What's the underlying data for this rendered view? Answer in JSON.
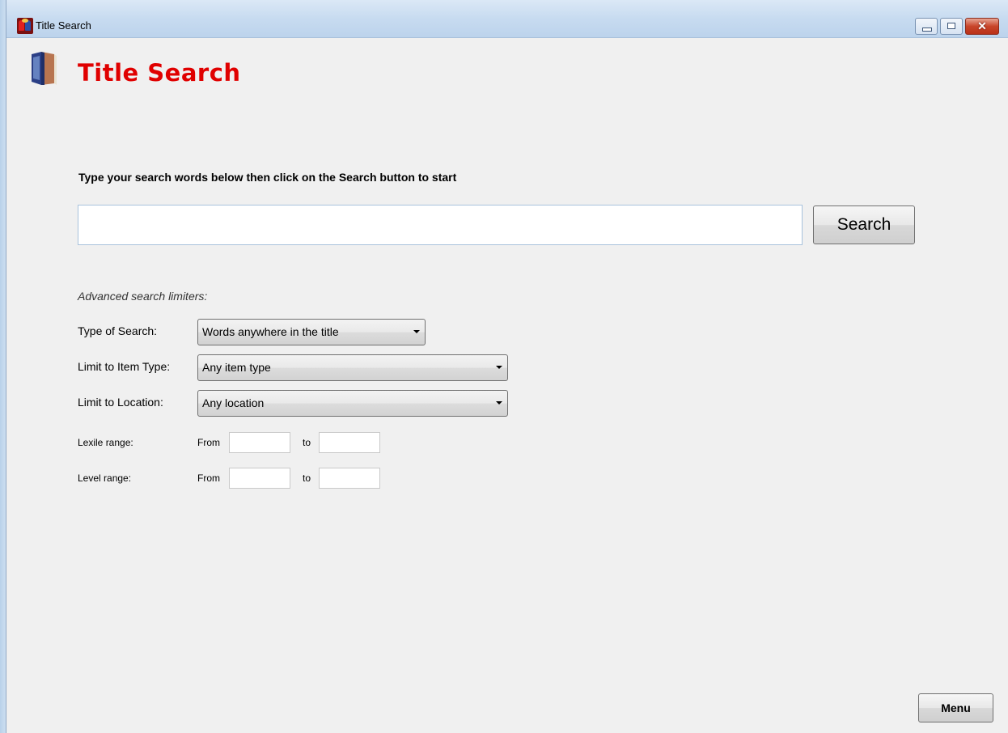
{
  "window": {
    "title": "Title Search",
    "controls": {
      "minimize": "minimize",
      "maximize": "maximize",
      "close": "✕"
    }
  },
  "page": {
    "heading": "Title Search"
  },
  "search": {
    "instructions": "Type your search words below then click on the Search button to start",
    "value": "",
    "button_label": "Search"
  },
  "advanced": {
    "label": "Advanced search limiters:",
    "type_of_search": {
      "label": "Type of Search:",
      "selected": "Words anywhere in the title"
    },
    "item_type": {
      "label": "Limit to Item Type:",
      "selected": "Any item type"
    },
    "location": {
      "label": "Limit to Location:",
      "selected": "Any location"
    },
    "lexile_range": {
      "label": "Lexile range:",
      "from_label": "From",
      "to_label": "to",
      "from_value": "",
      "to_value": ""
    },
    "level_range": {
      "label": "Level range:",
      "from_label": "From",
      "to_label": "to",
      "from_value": "",
      "to_value": ""
    }
  },
  "footer": {
    "menu_label": "Menu"
  },
  "colors": {
    "heading": "#e00000",
    "titlebar": "#c7dbf0"
  }
}
